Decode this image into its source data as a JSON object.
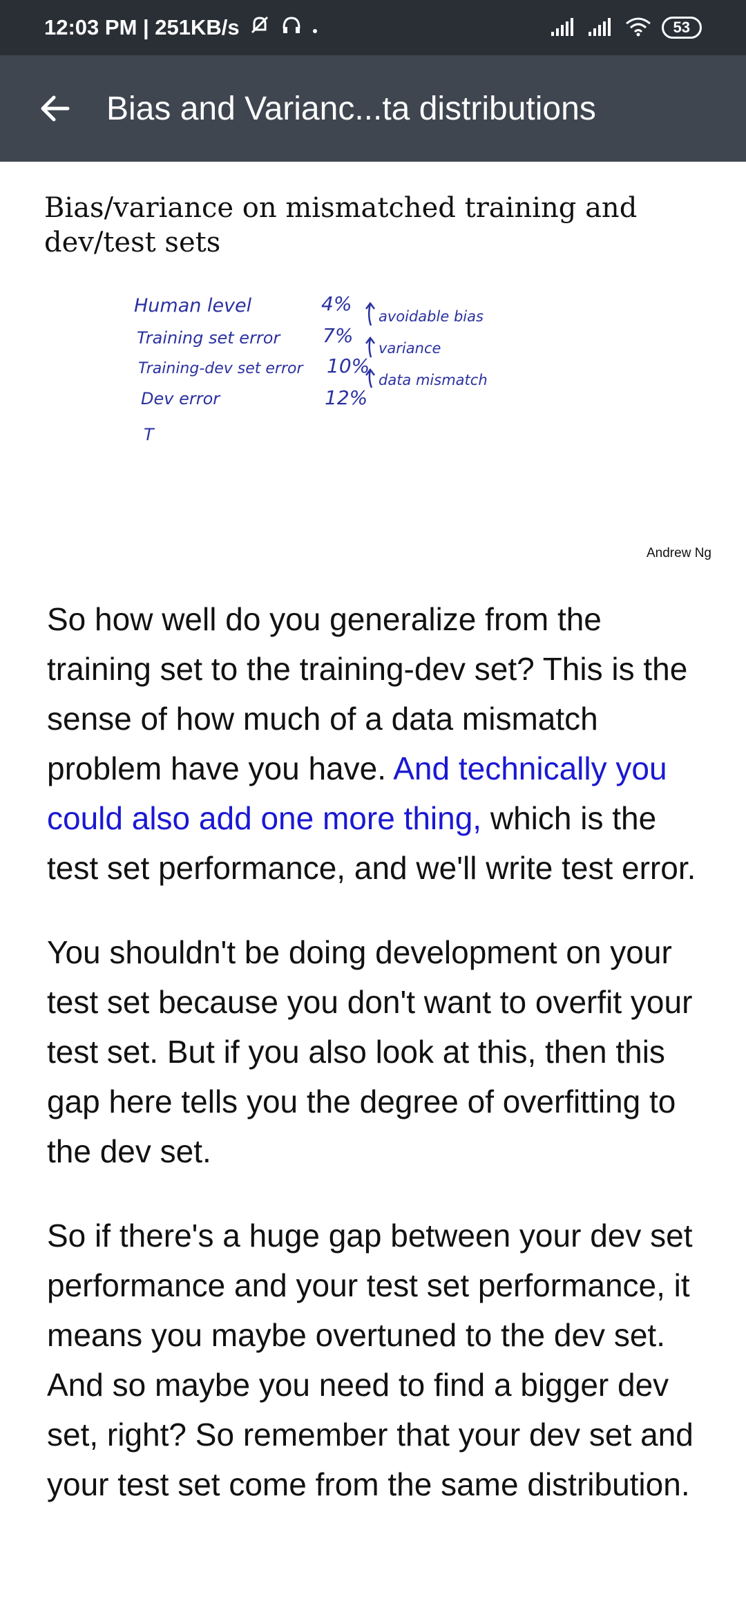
{
  "status_bar": {
    "time_speed": "12:03 PM | 251KB/s",
    "battery": "53"
  },
  "app_bar": {
    "title": "Bias and Varianc...ta distributions"
  },
  "slide": {
    "title": "Bias/variance on mismatched training and dev/test sets",
    "handwriting": {
      "rows": [
        {
          "label": "Human level",
          "value": "4%"
        },
        {
          "label": "Training set error",
          "value": "7%"
        },
        {
          "label": "Training-dev set error",
          "value": "10%"
        },
        {
          "label": "Dev error",
          "value": "12%"
        },
        {
          "label": "T",
          "value": ""
        }
      ],
      "gaps": [
        "avoidable bias",
        "variance",
        "data mismatch"
      ]
    },
    "credit": "Andrew Ng"
  },
  "transcript": {
    "p1_before": "So how well do you generalize from the training set to the training-dev set? This is the sense of how much of a data mismatch problem have you have. ",
    "p1_highlight": "And technically you could also add one more thing,",
    "p1_after": " which is the test set performance, and we'll write test error.",
    "p2": "You shouldn't be doing development on your test set because you don't want to overfit your test set. But if you also look at this, then this gap here tells you the degree of overfitting to the dev set.",
    "p3": "So if there's a huge gap between your dev set performance and your test set performance, it means you maybe overtuned to the dev set. And so maybe you need to find a bigger dev set, right? So remember that your dev set and your test set come from the same distribution."
  }
}
